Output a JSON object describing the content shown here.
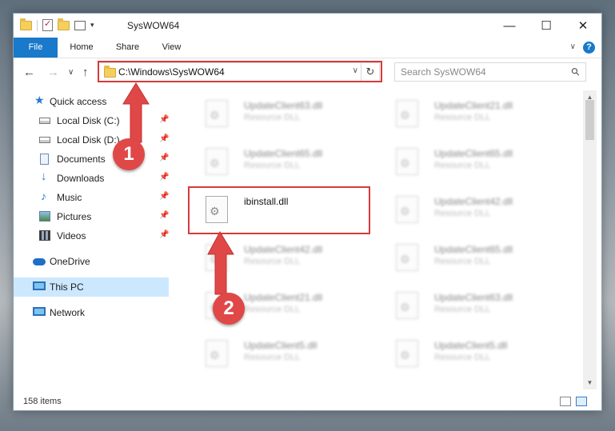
{
  "window": {
    "title": "SysWOW64",
    "minimize": "—",
    "maximize": "☐",
    "close": "✕"
  },
  "ribbon": {
    "tabs": [
      "File",
      "Home",
      "Share",
      "View"
    ],
    "help": "?"
  },
  "nav": {
    "back": "←",
    "forward": "→",
    "recent": "∨",
    "up": "↑",
    "address": "C:\\Windows\\SysWOW64",
    "refresh": "↻",
    "search_placeholder": "Search SysWOW64"
  },
  "sidebar": {
    "items": [
      {
        "label": "Quick access",
        "icon": "star-icon",
        "pinned": false
      },
      {
        "label": "Local Disk (C:)",
        "icon": "drive-icon",
        "pinned": true
      },
      {
        "label": "Local Disk (D:)",
        "icon": "drive-icon",
        "pinned": true
      },
      {
        "label": "Documents",
        "icon": "documents-icon",
        "pinned": true
      },
      {
        "label": "Downloads",
        "icon": "downloads-icon",
        "pinned": true
      },
      {
        "label": "Music",
        "icon": "music-icon",
        "pinned": true
      },
      {
        "label": "Pictures",
        "icon": "pictures-icon",
        "pinned": true
      },
      {
        "label": "Videos",
        "icon": "videos-icon",
        "pinned": true
      },
      {
        "label": "OneDrive",
        "icon": "onedrive-icon",
        "pinned": false
      },
      {
        "label": "This PC",
        "icon": "this-pc-icon",
        "pinned": false,
        "selected": true
      },
      {
        "label": "Network",
        "icon": "network-icon",
        "pinned": false
      }
    ],
    "pin_glyph": "📌"
  },
  "files": [
    {
      "name": "UpdateClient63.dll",
      "type": "Resource DLL"
    },
    {
      "name": "UpdateClient21.dll",
      "type": "Resource DLL"
    },
    {
      "name": "UpdateClient65.dll",
      "type": "Resource DLL"
    },
    {
      "name": "UpdateClient65.dll",
      "type": "Resource DLL"
    },
    {
      "name": "ibinstall.dll",
      "type": ""
    },
    {
      "name": "UpdateClient42.dll",
      "type": "Resource DLL"
    },
    {
      "name": "UpdateClient42.dll",
      "type": "Resource DLL"
    },
    {
      "name": "UpdateClient65.dll",
      "type": "Resource DLL"
    },
    {
      "name": "UpdateClient21.dll",
      "type": "Resource DLL"
    },
    {
      "name": "UpdateClient63.dll",
      "type": "Resource DLL"
    },
    {
      "name": "UpdateClient5.dll",
      "type": "Resource DLL"
    },
    {
      "name": "UpdateClient5.dll",
      "type": "Resource DLL"
    }
  ],
  "status": {
    "item_count": "158 items"
  },
  "annotations": {
    "step1": "1",
    "step2": "2",
    "color": "#d63a3a"
  }
}
